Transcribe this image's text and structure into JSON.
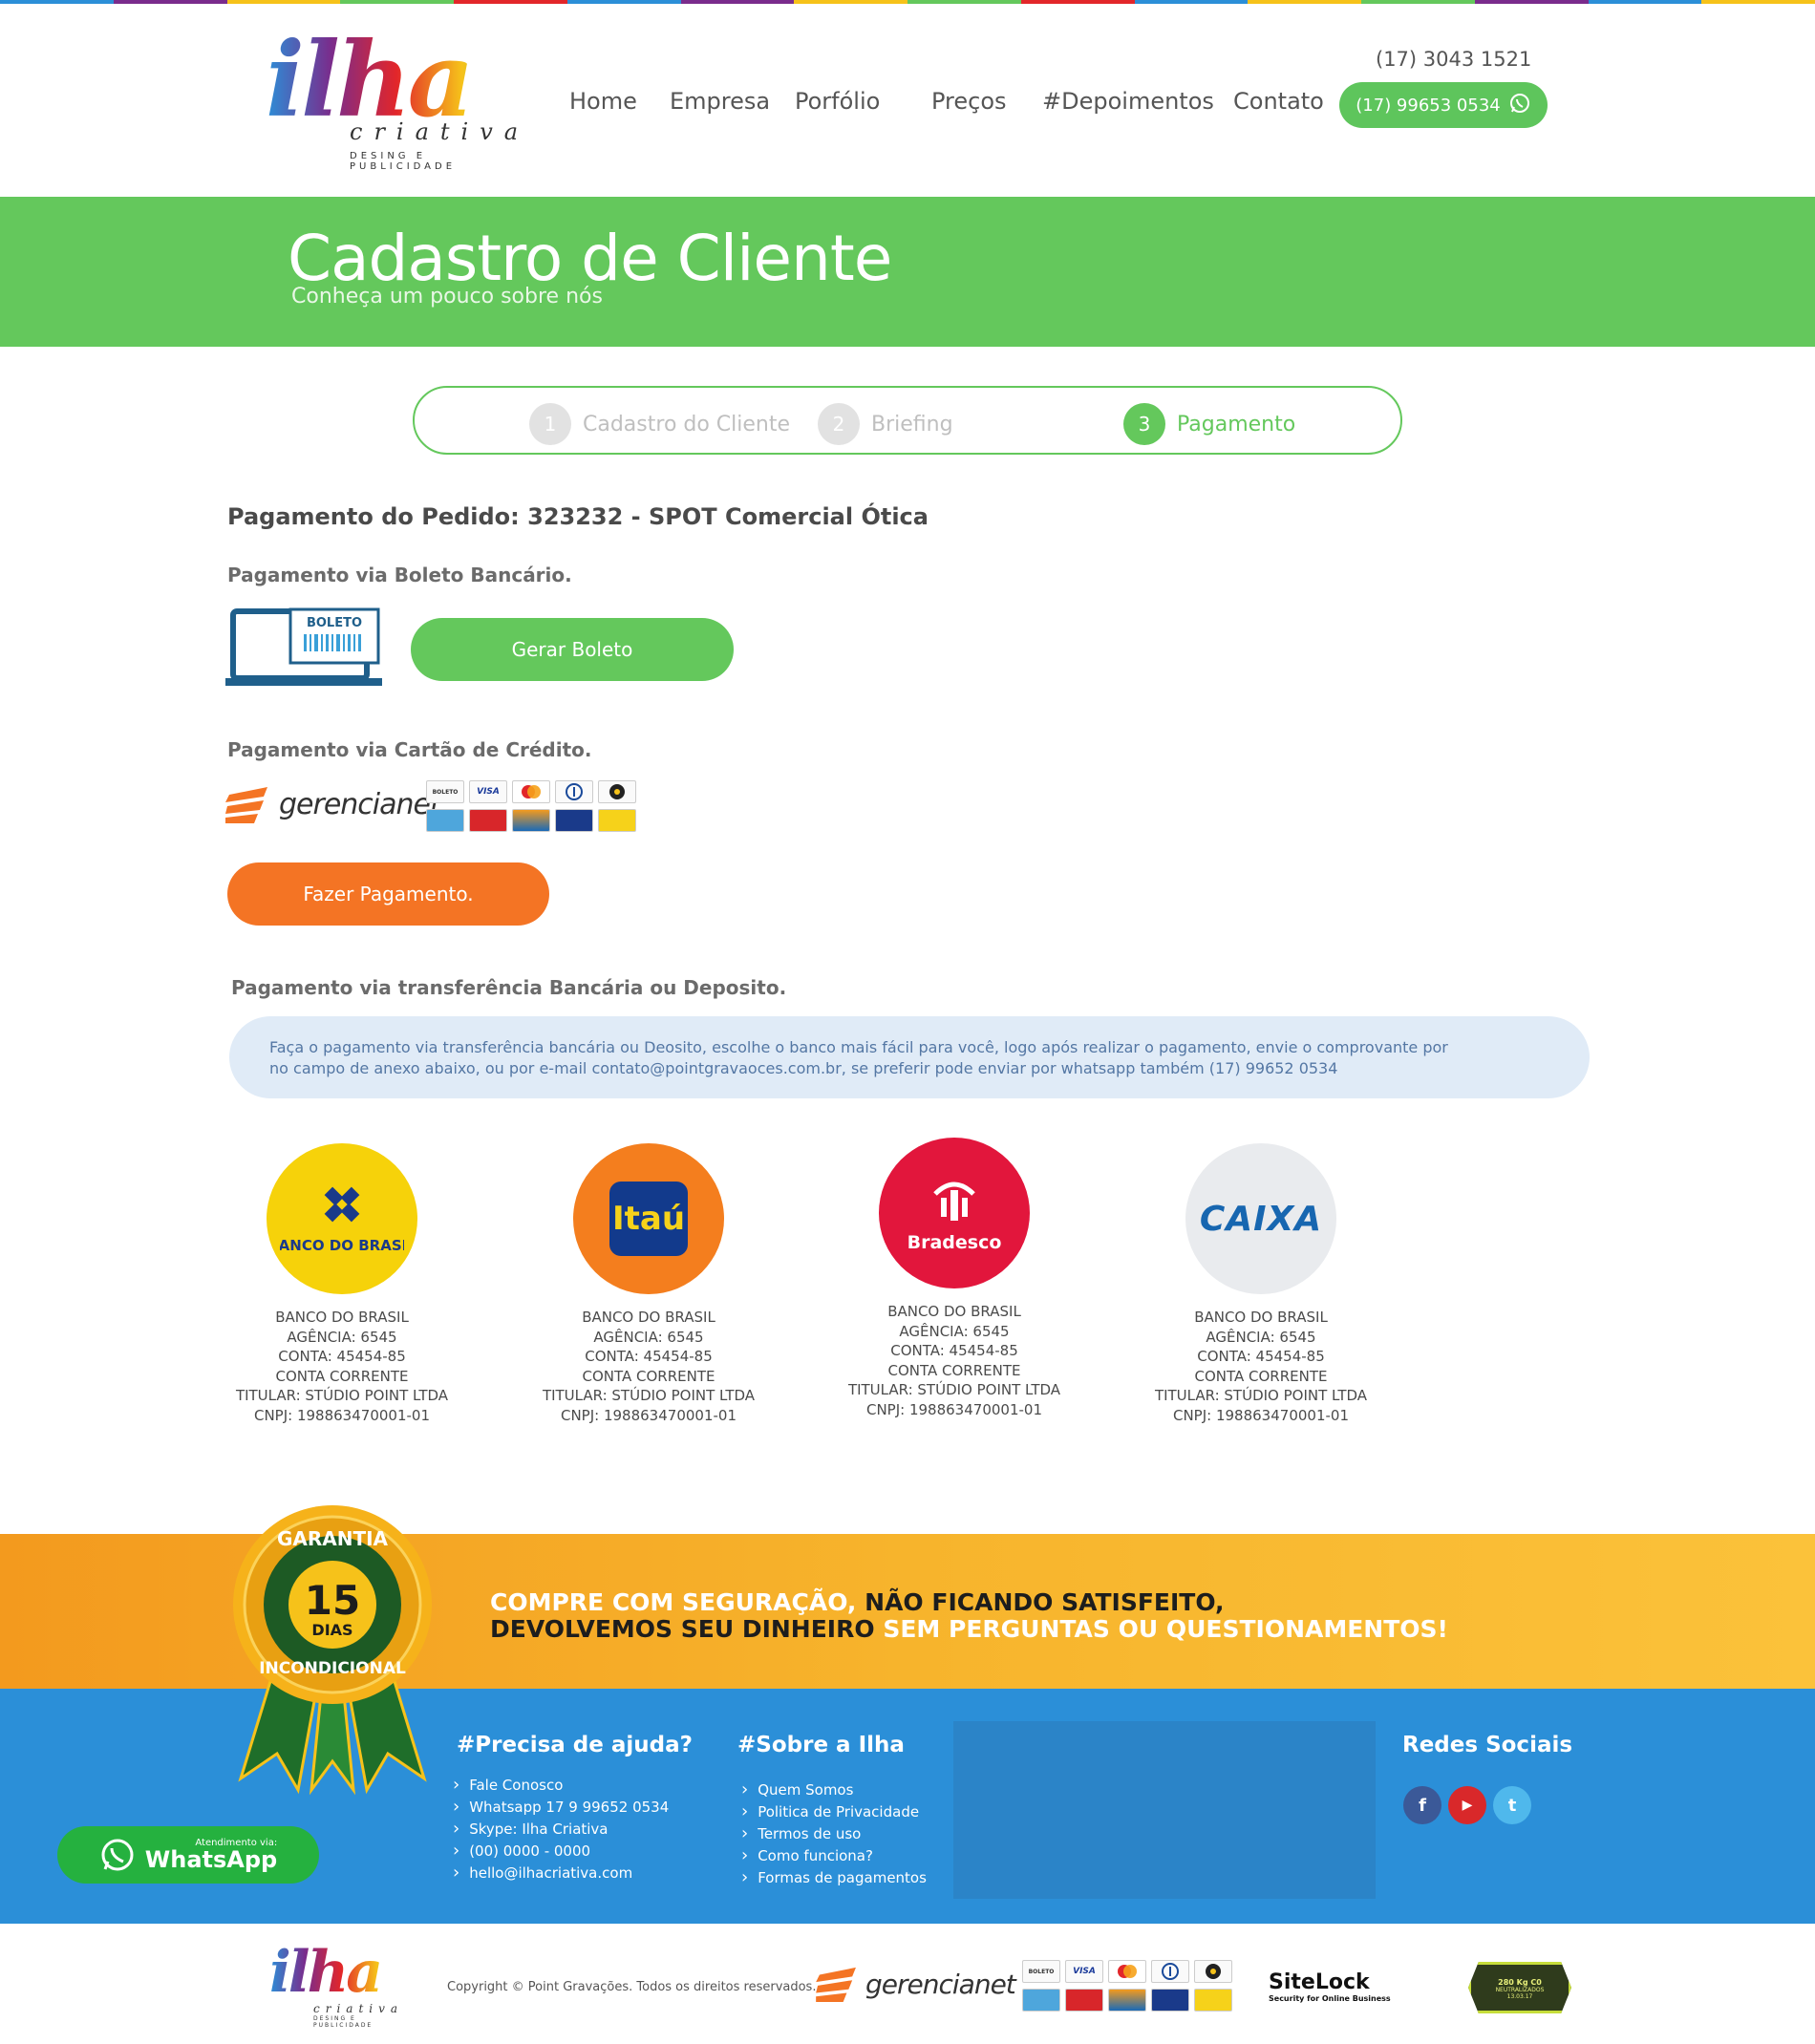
{
  "header": {
    "logo_word": "ilha",
    "logo_sub": "criativa",
    "logo_tagline": "DESING E PUBLICIDADE",
    "nav": [
      "Home",
      "Empresa",
      "Porfólio",
      "Preços",
      "#Depoimentos",
      "Contato"
    ],
    "phone": "(17) 3043 1521",
    "whatsapp_phone": "(17) 99653 0534"
  },
  "banner": {
    "title": "Cadastro de Cliente",
    "subtitle": "Conheça um pouco sobre nós"
  },
  "steps": [
    {
      "num": "1",
      "label": "Cadastro do Cliente",
      "active": false
    },
    {
      "num": "2",
      "label": "Briefing",
      "active": false
    },
    {
      "num": "3",
      "label": "Pagamento",
      "active": true
    }
  ],
  "order": {
    "heading": "Pagamento do Pedido: 323232 - SPOT Comercial Ótica"
  },
  "boleto": {
    "heading": "Pagamento via Boleto Bancário.",
    "icon_label": "BOLETO",
    "button": "Gerar Boleto"
  },
  "card": {
    "heading": "Pagamento via Cartão de Crédito.",
    "provider": "gerencianet",
    "brands": [
      "BOLETO",
      "VISA",
      "MC",
      "DINERS",
      "ELO",
      "AMEX",
      "HIPER",
      "AURA",
      "ITAU",
      "BB"
    ],
    "button": "Fazer Pagamento."
  },
  "transfer": {
    "heading": "Pagamento via transferência Bancária ou Deposito.",
    "info_line1": "Faça o pagamento via transferência bancária ou Deosito, escolhe o banco mais fácil para você, logo após realizar o pagamento, envie o comprovante por",
    "info_line2": "no campo de anexo abaixo, ou por e-mail contato@pointgravaoces.com.br, se preferir pode enviar por whatsapp também (17) 99652 0534"
  },
  "banks": [
    {
      "logo": "BANCO DO BRASIL",
      "name": "BANCO DO BRASIL",
      "agencia": "AGÊNCIA: 6545",
      "conta": "CONTA: 45454-85",
      "tipo": "CONTA CORRENTE",
      "titular": "TITULAR: STÚDIO POINT LTDA",
      "cnpj": "CNPJ: 198863470001-01"
    },
    {
      "logo": "Itaú",
      "name": "BANCO DO BRASIL",
      "agencia": "AGÊNCIA: 6545",
      "conta": "CONTA: 45454-85",
      "tipo": "CONTA CORRENTE",
      "titular": "TITULAR: STÚDIO POINT LTDA",
      "cnpj": "CNPJ: 198863470001-01"
    },
    {
      "logo": "Bradesco",
      "name": "BANCO DO BRASIL",
      "agencia": "AGÊNCIA: 6545",
      "conta": "CONTA: 45454-85",
      "tipo": "CONTA CORRENTE",
      "titular": "TITULAR: STÚDIO POINT LTDA",
      "cnpj": "CNPJ: 198863470001-01"
    },
    {
      "logo": "CAIXA",
      "name": "BANCO DO BRASIL",
      "agencia": "AGÊNCIA: 6545",
      "conta": "CONTA: 45454-85",
      "tipo": "CONTA CORRENTE",
      "titular": "TITULAR: STÚDIO POINT LTDA",
      "cnpj": "CNPJ: 198863470001-01"
    }
  ],
  "guarantee": {
    "badge_top": "GARANTIA",
    "badge_number": "15",
    "badge_unit": "DIAS",
    "badge_bottom": "INCONDICIONAL",
    "line1_a": "COMPRE COM SEGURAÇÃO,",
    "line1_b": "NÃO FICANDO SATISFEITO,",
    "line2_a": "DEVOLVEMOS SEU DINHEIRO",
    "line2_b": "SEM PERGUNTAS OU QUESTIONAMENTOS!"
  },
  "footer": {
    "help_title": "#Precisa de ajuda?",
    "help_links": [
      "Fale Conosco",
      "Whatsapp 17 9 99652 0534",
      "Skype: Ilha Criativa",
      "(00) 0000 - 0000",
      "hello@ilhacriativa.com"
    ],
    "about_title": "#Sobre a Ilha",
    "about_links": [
      "Quem Somos",
      "Politica de Privacidade",
      "Termos de uso",
      "Como funciona?",
      "Formas de pagamentos"
    ],
    "social_title": "Redes Sociais",
    "social": [
      "f",
      "▶",
      "t"
    ],
    "whatsapp_small": "Atendimento via:",
    "whatsapp_big": "WhatsApp"
  },
  "bottom": {
    "copyright": "Copyright © Point Gravações. Todos os direitos reservados.",
    "sitelock": "SiteLock",
    "sitelock_sub": "Security for Online Business",
    "co2_line1": "280 Kg C0",
    "co2_line2": "NEUTRALIZADOS",
    "co2_line3": "13.03.17"
  },
  "colors": {
    "green": "#64c85c",
    "orange": "#f47424",
    "blue": "#2b8fd8",
    "info_bg": "#e0ebf7"
  }
}
